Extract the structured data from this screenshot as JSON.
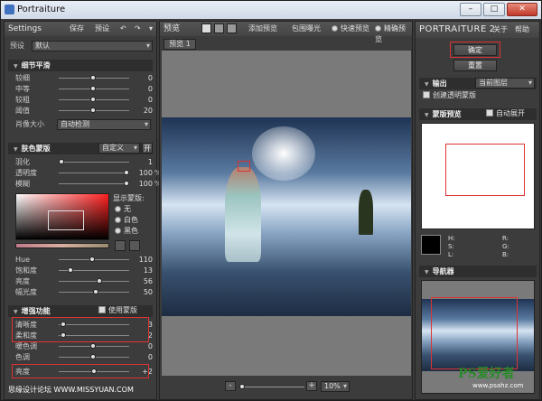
{
  "window": {
    "title": "Portraiture",
    "minimize": "–",
    "maximize": "□",
    "close": "✕"
  },
  "left": {
    "header": "Settings",
    "save": "保存",
    "preset": "预设",
    "preset_label": "预设",
    "preset_value": "默认",
    "detail_title": "细节平滑",
    "detail_rows": [
      {
        "label": "较细",
        "value": "0"
      },
      {
        "label": "中等",
        "value": "0"
      },
      {
        "label": "较粗",
        "value": "0"
      },
      {
        "label": "阈值",
        "value": "20"
      }
    ],
    "portrait_size_label": "肖像大小",
    "portrait_size_value": "自动检测",
    "mask_title": "肤色蒙版",
    "mask_mode": "自定义",
    "mask_mode_btn": "开",
    "mask_rows": [
      {
        "label": "羽化",
        "value": "1",
        "unit": ""
      },
      {
        "label": "透明度",
        "value": "100",
        "unit": "%"
      },
      {
        "label": "模糊",
        "value": "100",
        "unit": "%"
      }
    ],
    "show_mask_label": "显示蒙版:",
    "show_mask_options": [
      "无",
      "白色",
      "黑色"
    ],
    "hue_rows": [
      {
        "label": "Hue",
        "value": "110"
      },
      {
        "label": "饱和度",
        "value": "13"
      },
      {
        "label": "亮度",
        "value": "56"
      },
      {
        "label": "幅光度",
        "value": "50"
      }
    ],
    "enhance_title": "增强功能",
    "use_mask": "使用蒙版",
    "enhance_rows": [
      {
        "label": "清晰度",
        "value": "3"
      },
      {
        "label": "柔和度",
        "value": "2"
      },
      {
        "label": "暖色调",
        "value": "0"
      },
      {
        "label": "色调",
        "value": "0"
      },
      {
        "label": "亮度",
        "value": "+2"
      }
    ],
    "watermark": "思缘设计论坛 WWW.MISSYUAN.COM"
  },
  "center": {
    "preview": "预览",
    "add_preview": "添加预览",
    "crop": "包围曝光",
    "fast_preview": "快速预览",
    "accurate_preview": "精确预览",
    "tab": "预览 1",
    "zoom_value": "10%",
    "minus": "-",
    "plus": "+"
  },
  "right": {
    "brand": "PORTRAITURE",
    "version": "2",
    "about": "关于",
    "help": "帮助",
    "ok": "确定",
    "reset": "重置",
    "output_title": "输出",
    "output_value": "当前图层",
    "transparent_mask": "创建透明蒙版",
    "mask_preview_title": "蒙版预览",
    "auto_expand": "自动展开",
    "hsl_labels": [
      "H:",
      "S:",
      "L:"
    ],
    "rgb_labels": [
      "R:",
      "G:",
      "B:"
    ],
    "navigator_title": "导航器",
    "logo": "PS爱好者",
    "logo_url": "www.psahz.com"
  },
  "colors": {
    "accent_red": "#dd3333",
    "panel": "#3c3c3c",
    "canvas_bg": "#7a7a7a"
  }
}
